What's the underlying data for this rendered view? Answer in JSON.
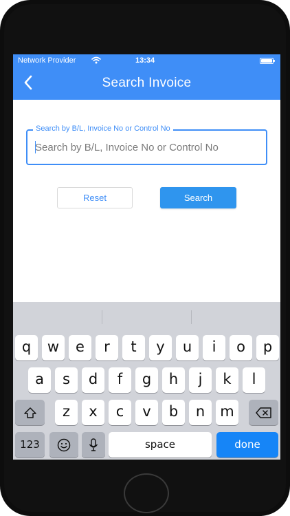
{
  "status_bar": {
    "carrier": "Network Provider",
    "time": "13:34",
    "icons": [
      "wifi-icon",
      "battery-icon"
    ]
  },
  "nav": {
    "title": "Search Invoice",
    "back_icon": "chevron-left-icon"
  },
  "search": {
    "label": "Search by B/L, Invoice No or Control No",
    "placeholder": "Search by B/L, Invoice No or Control No",
    "value": ""
  },
  "buttons": {
    "reset": "Reset",
    "search": "Search"
  },
  "keyboard": {
    "row1": [
      "q",
      "w",
      "e",
      "r",
      "t",
      "y",
      "u",
      "i",
      "o",
      "p"
    ],
    "row2": [
      "a",
      "s",
      "d",
      "f",
      "g",
      "h",
      "j",
      "k",
      "l"
    ],
    "row3": [
      "z",
      "x",
      "c",
      "v",
      "b",
      "n",
      "m"
    ],
    "numbers": "123",
    "space": "space",
    "done": "done",
    "icons": [
      "shift-icon",
      "backspace-icon",
      "emoji-icon",
      "microphone-icon"
    ]
  },
  "colors": {
    "accent": "#3f8ef7",
    "search_button": "#2f95ee",
    "done_key": "#1685f7",
    "keyboard_bg": "#d1d3d9"
  }
}
